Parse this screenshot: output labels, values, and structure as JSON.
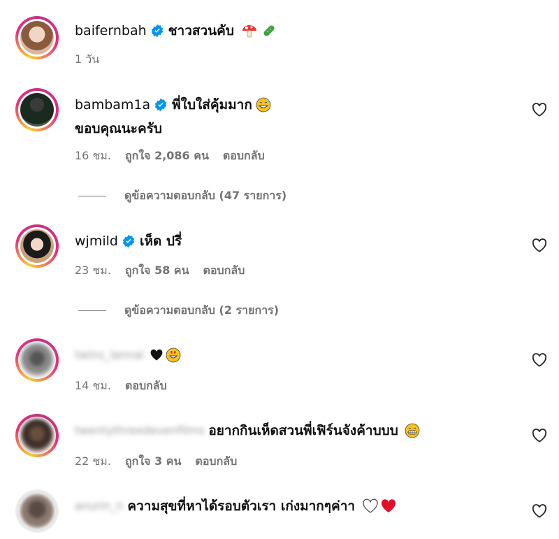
{
  "comments": [
    {
      "username": "baifernbah",
      "verified": true,
      "text": "ชาวสวนคับ",
      "time": "1 วัน",
      "likes": "",
      "reply": ""
    },
    {
      "username": "bambam1a",
      "verified": true,
      "text": "พี่ใบใส่คุ้มมาก",
      "text2": "ขอบคุณนะครับ",
      "time": "16 ชม.",
      "likes": "ถูกใจ 2,086 คน",
      "reply": "ตอบกลับ",
      "view_replies": "ดูข้อความตอบกลับ (47 รายการ)"
    },
    {
      "username": "wjmild",
      "verified": true,
      "text": "เห็ด ปรี่",
      "time": "23 ชม.",
      "likes": "ถูกใจ 58 คน",
      "reply": "ตอบกลับ",
      "view_replies": "ดูข้อความตอบกลับ (2 รายการ)"
    },
    {
      "username": "twins_lannai",
      "verified": false,
      "text": "",
      "time": "14 ชม.",
      "likes": "",
      "reply": "ตอบกลับ"
    },
    {
      "username": "twentythreedevenfilms",
      "verified": false,
      "text": "อยากกินเห็ดสวนพี่เฟิร์นจังค้าบบบ",
      "time": "22 ชม.",
      "likes": "ถูกใจ 3 คน",
      "reply": "ตอบกลับ"
    },
    {
      "username": "anurin_n",
      "verified": false,
      "text": "ความสุขที่หาได้รอบตัวเรา เก่งมากๆค่าา",
      "time": "",
      "likes": "",
      "reply": ""
    }
  ],
  "icons": {
    "verified": "verified-badge-icon",
    "like": "heart-outline-icon"
  },
  "colors": {
    "verified": "#0095f6",
    "meta": "#737373"
  }
}
